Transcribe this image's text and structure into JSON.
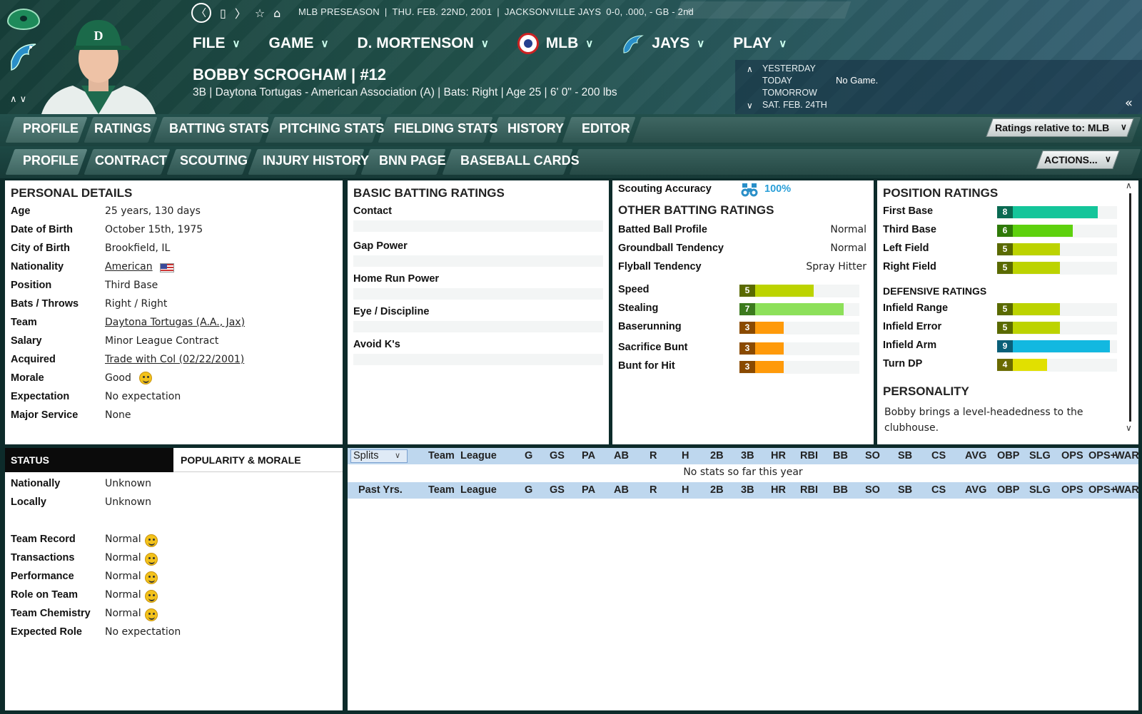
{
  "header": {
    "info": [
      "MLB PRESEASON",
      "|",
      "THU. FEB. 22ND, 2001",
      "|",
      "JACKSONVILLE JAYS",
      "0-0, .000, - GB - 2nd"
    ],
    "menu": [
      {
        "label": "FILE"
      },
      {
        "label": "GAME"
      },
      {
        "label": "D. MORTENSON"
      },
      {
        "label": "MLB"
      },
      {
        "label": "JAYS"
      },
      {
        "label": "PLAY"
      }
    ],
    "player_name": "BOBBY SCROGHAM  |  #12",
    "player_sub": "3B | Daytona Tortugas - American Association (A)  |  Bats: Right  |  Age 25  |  6' 0\" - 200 lbs",
    "dates": [
      "YESTERDAY",
      "TODAY",
      "TOMORROW",
      "SAT. FEB. 24TH"
    ],
    "today_game": "No Game.",
    "up_arrow": "∧",
    "down_arrow": "∨",
    "collapse": "«"
  },
  "tabs_main": [
    "PROFILE",
    "RATINGS",
    "BATTING STATS",
    "PITCHING STATS",
    "FIELDING STATS",
    "HISTORY",
    "EDITOR"
  ],
  "tabs_sub": [
    "PROFILE",
    "CONTRACT",
    "SCOUTING",
    "INJURY HISTORY",
    "BNN PAGE",
    "BASEBALL CARDS"
  ],
  "ratings_relative": "Ratings relative to: MLB",
  "actions": "ACTIONS...",
  "personal": {
    "title": "PERSONAL DETAILS",
    "rows": [
      {
        "label": "Age",
        "value": "25 years, 130 days"
      },
      {
        "label": "Date of Birth",
        "value": "October 15th, 1975"
      },
      {
        "label": "City of Birth",
        "value": "Brookfield, IL"
      },
      {
        "label": "Nationality",
        "value": "American"
      },
      {
        "label": "Position",
        "value": "Third Base"
      },
      {
        "label": "Bats / Throws",
        "value": "Right / Right"
      },
      {
        "label": "Team",
        "value": "Daytona Tortugas (A.A., Jax)"
      },
      {
        "label": "Salary",
        "value": "Minor League Contract"
      },
      {
        "label": "Acquired",
        "value": "Trade with Col (02/22/2001)"
      },
      {
        "label": "Morale",
        "value": "Good"
      },
      {
        "label": "Expectation",
        "value": "No expectation"
      },
      {
        "label": "Major Service",
        "value": "None"
      }
    ]
  },
  "basic_batting": {
    "title": "BASIC BATTING RATINGS",
    "rows": [
      "Contact",
      "Gap Power",
      "Home Run Power",
      "Eye / Discipline",
      "Avoid K's"
    ]
  },
  "other_batting": {
    "scouting_label": "Scouting Accuracy",
    "scouting_value": "100%",
    "title": "OTHER BATTING RATINGS",
    "text_rows": [
      {
        "label": "Batted Ball Profile",
        "value": "Normal"
      },
      {
        "label": "Groundball Tendency",
        "value": "Normal"
      },
      {
        "label": "Flyball Tendency",
        "value": "Spray Hitter"
      }
    ],
    "bar_rows": [
      {
        "label": "Speed",
        "value": 5,
        "display": "5",
        "color": "#bcd300",
        "numcolor": "#5a6a00"
      },
      {
        "label": "Stealing",
        "value": 7,
        "display": "7",
        "color": "#8de05a",
        "numcolor": "#3c7a1e"
      },
      {
        "label": "Baserunning",
        "value": 3,
        "display": "3",
        "color": "#ff9a0a",
        "numcolor": "#8a4a00"
      },
      {
        "label": "Sacrifice Bunt",
        "value": 3,
        "display": "3",
        "color": "#ff9a0a",
        "numcolor": "#8a4a00"
      },
      {
        "label": "Bunt for Hit",
        "value": 3,
        "display": "3",
        "color": "#ff9a0a",
        "numcolor": "#8a4a00"
      }
    ]
  },
  "position": {
    "title": "POSITION RATINGS",
    "rows": [
      {
        "label": "First Base",
        "value": 8,
        "display": "8",
        "color": "#14c59a",
        "numcolor": "#0a6a52"
      },
      {
        "label": "Third Base",
        "value": 6,
        "display": "6",
        "color": "#5ed10e",
        "numcolor": "#2f7a08"
      },
      {
        "label": "Left Field",
        "value": 5,
        "display": "5",
        "color": "#bcd300",
        "numcolor": "#5a6a00"
      },
      {
        "label": "Right Field",
        "value": 5,
        "display": "5",
        "color": "#bcd300",
        "numcolor": "#5a6a00"
      }
    ],
    "defensive_title": "DEFENSIVE RATINGS",
    "defensive": [
      {
        "label": "Infield Range",
        "value": 5,
        "display": "5",
        "color": "#bcd300",
        "numcolor": "#5a6a00"
      },
      {
        "label": "Infield Error",
        "value": 5,
        "display": "5",
        "color": "#bcd300",
        "numcolor": "#5a6a00"
      },
      {
        "label": "Infield Arm",
        "value": 9,
        "display": "9",
        "color": "#13b8e0",
        "numcolor": "#0a5f78"
      },
      {
        "label": "Turn DP",
        "value": 4,
        "display": "4",
        "color": "#e1e000",
        "numcolor": "#6a6a00"
      }
    ],
    "personality_title": "PERSONALITY",
    "personality_text": "Bobby brings a level-headedness to the clubhouse."
  },
  "status": {
    "tab_active": "STATUS",
    "tab_other": "POPULARITY & MORALE",
    "rows": [
      {
        "label": "Nationally",
        "value": "Unknown",
        "smiley": false
      },
      {
        "label": "Locally",
        "value": "Unknown",
        "smiley": false
      },
      {
        "label": "Team Record",
        "value": "Normal",
        "smiley": true
      },
      {
        "label": "Transactions",
        "value": "Normal",
        "smiley": true
      },
      {
        "label": "Performance",
        "value": "Normal",
        "smiley": true
      },
      {
        "label": "Role on Team",
        "value": "Normal",
        "smiley": true
      },
      {
        "label": "Team Chemistry",
        "value": "Normal",
        "smiley": true
      },
      {
        "label": "Expected Role",
        "value": "No expectation",
        "smiley": false
      }
    ]
  },
  "stats": {
    "splits": "Splits",
    "past": "Past Yrs.",
    "columns": [
      "Team",
      "League",
      "G",
      "GS",
      "PA",
      "AB",
      "R",
      "H",
      "2B",
      "3B",
      "HR",
      "RBI",
      "BB",
      "SO",
      "SB",
      "CS",
      "AVG",
      "OBP",
      "SLG",
      "OPS",
      "OPS+",
      "WAR"
    ],
    "empty_msg": "No stats so far this year"
  }
}
